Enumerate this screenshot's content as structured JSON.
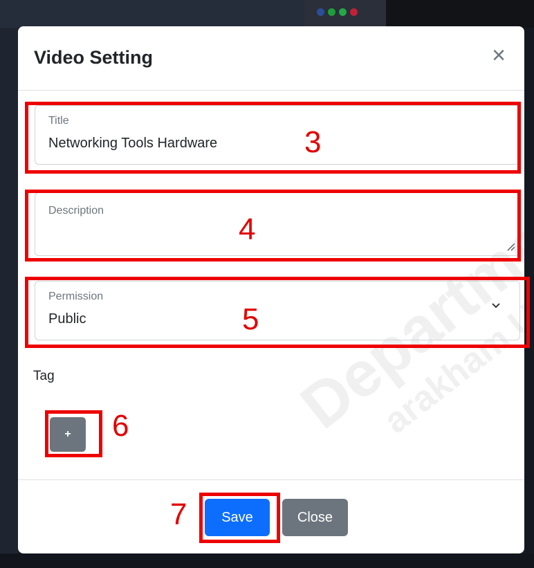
{
  "modal": {
    "title": "Video Setting",
    "close_icon": "×"
  },
  "form": {
    "title": {
      "label": "Title",
      "value": "Networking Tools Hardware"
    },
    "description": {
      "label": "Description",
      "value": ""
    },
    "permission": {
      "label": "Permission",
      "value": "Public"
    },
    "tag": {
      "label": "Tag",
      "add_button_label": "+"
    }
  },
  "footer": {
    "save_label": "Save",
    "close_label": "Close"
  },
  "watermark": {
    "line1": "Departme",
    "line2": "arakham U"
  },
  "annotations": [
    "3",
    "4",
    "5",
    "6",
    "7"
  ],
  "colors": {
    "primary": "#0d6efd",
    "secondary": "#6c757d",
    "annotation": "#ee0000"
  },
  "icons": [
    "close-icon",
    "resize-grip-icon",
    "chevron-down-icon"
  ]
}
